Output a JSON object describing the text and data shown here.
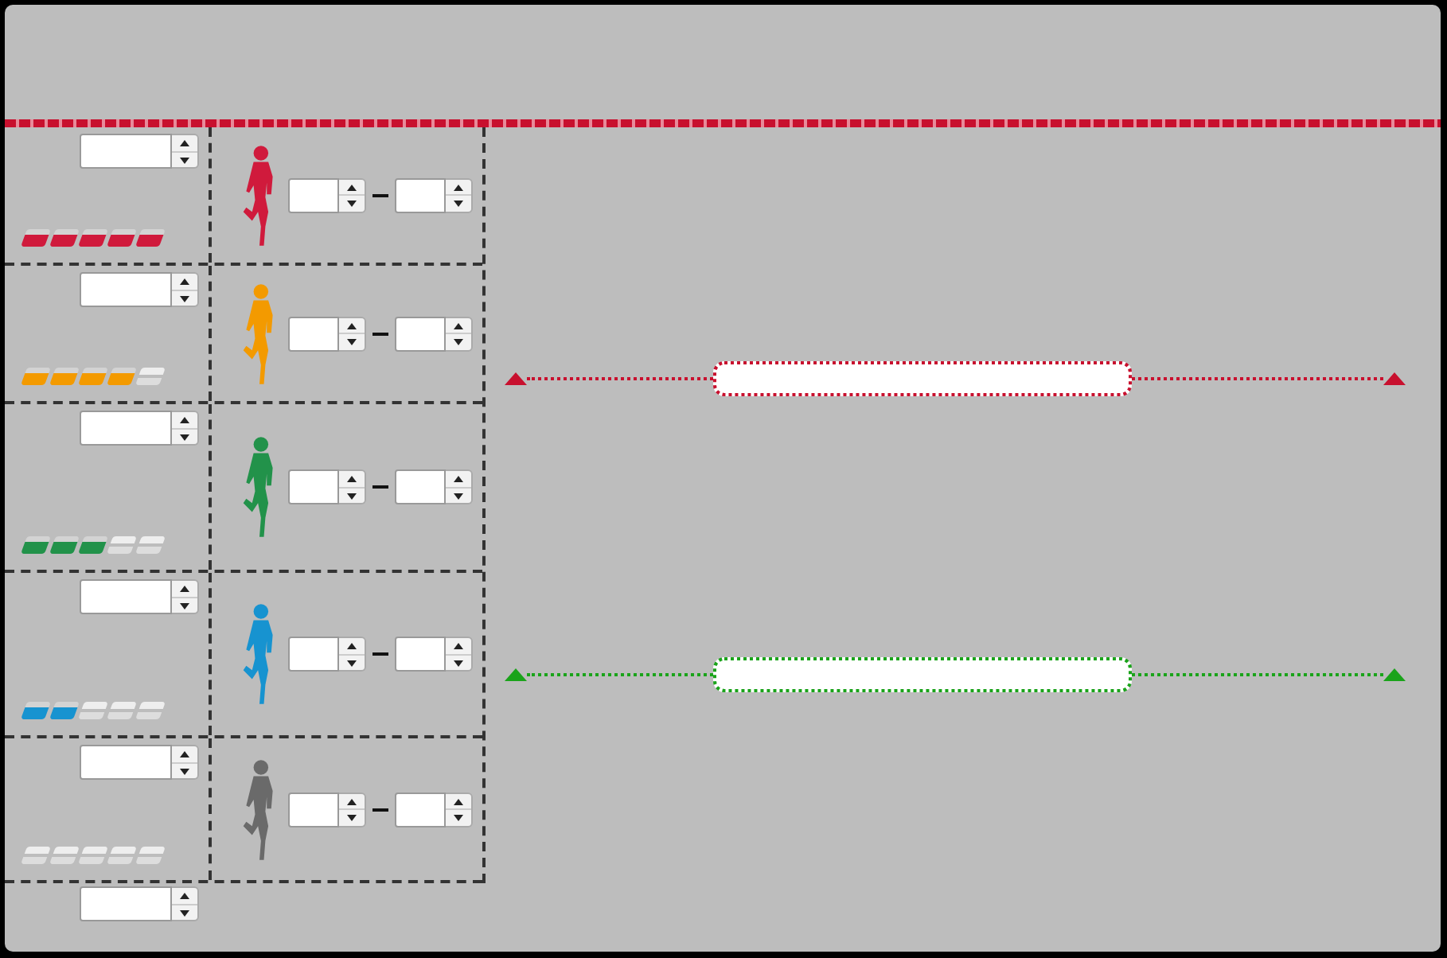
{
  "rows": [
    {
      "color": "#d01a3c",
      "stars": 5
    },
    {
      "color": "#f39a00",
      "stars": 4
    },
    {
      "color": "#22924a",
      "stars": 3
    },
    {
      "color": "#1793d0",
      "stars": 2
    },
    {
      "color": "#6a6a6a",
      "stars": 0
    }
  ],
  "ranges": [
    {
      "color": "#c8102e"
    },
    {
      "color": "#1aa31a"
    }
  ]
}
